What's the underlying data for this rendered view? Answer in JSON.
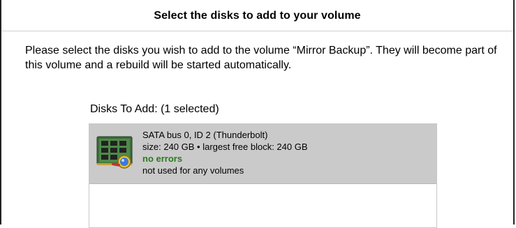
{
  "dialog": {
    "title": "Select the disks to add to your volume",
    "instructions": "Please select the disks you wish to add to the volume “Mirror Backup”.  They will become part of this volume and a rebuild will be started automatically.",
    "disks_label": "Disks To Add: (1 selected)"
  },
  "disks": [
    {
      "name": "SATA bus 0, ID 2 (Thunderbolt)",
      "size_info": "size: 240 GB • largest free block: 240 GB",
      "status": "no errors",
      "usage": "not used for any volumes",
      "icon": "ssd-disk-with-magnifier-icon",
      "selected": true
    }
  ],
  "colors": {
    "selected_row": "#cacaca",
    "status_ok": "#2a7a1e"
  }
}
